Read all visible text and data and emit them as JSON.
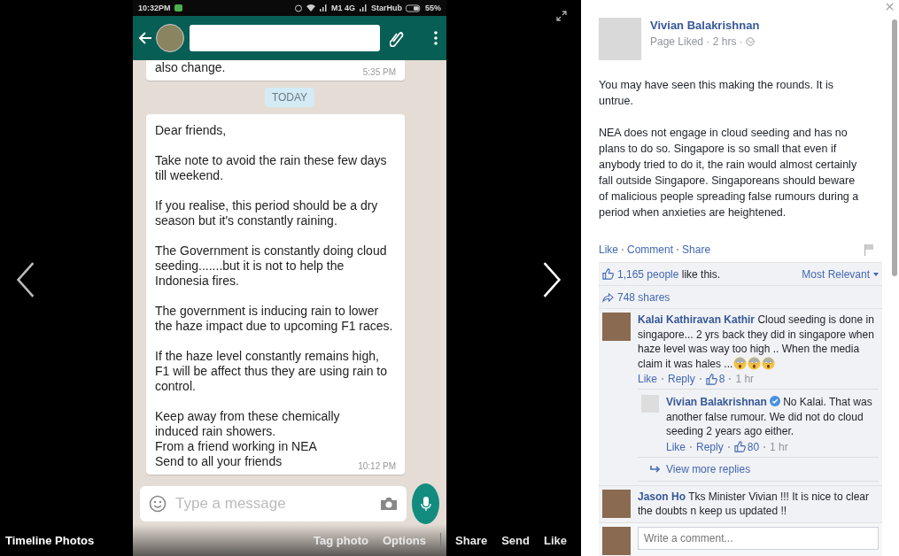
{
  "photo_viewer": {
    "album": "Timeline Photos",
    "photo_actions": [
      "Tag photo",
      "Options"
    ],
    "share_actions": [
      "Share",
      "Send",
      "Like"
    ]
  },
  "phone": {
    "status_bar": {
      "time": "10:32PM",
      "carrier_1": "M1 4G",
      "carrier_2": "StarHub",
      "battery": "55%"
    },
    "messages": [
      {
        "kind": "bubble",
        "paragraphs": [
          "also change."
        ],
        "time": "5:35 PM"
      },
      {
        "kind": "date",
        "text": "TODAY"
      },
      {
        "kind": "bubble",
        "paragraphs": [
          "Dear friends,",
          "Take note to avoid the rain these few days till weekend.",
          "If you realise, this period should be a dry season but it's constantly raining.",
          "The Government is constantly doing cloud seeding.......but it is not to help the Indonesia fires.",
          "The government is inducing rain to lower the haze impact due to upcoming F1 races.",
          "If the haze level constantly remains high, F1 will be affect thus they are using rain to control.",
          "Keep away from these chemically induced rain showers.\nFrom a friend working in NEA\nSend to all your friends"
        ],
        "time": "10:12 PM"
      }
    ],
    "composer": {
      "placeholder": "Type a message"
    }
  },
  "post": {
    "author": "Vivian Balakrishnan",
    "meta": "Page Liked · 2 hrs ·",
    "paragraphs": [
      "You may have seen this making the rounds. It is untrue.",
      "NEA does not engage in cloud seeding and has no plans to do so. Singapore is so small that even if anybody tried to do it, the rain would almost certainly fall outside Singapore. Singaporeans should beware of malicious people spreading false rumours during a period when anxieties are heightened."
    ],
    "actions": [
      "Like",
      "Comment",
      "Share"
    ],
    "likes": {
      "count": "1,165 people",
      "suffix": "like this."
    },
    "sort": "Most Relevant",
    "shares": "748 shares",
    "comments": [
      {
        "author": "Kalai Kathiravan Kathir",
        "verified": false,
        "text": "Cloud seeding is done in singapore... 2 yrs back they did in singapore when haze level was way too high .. When the media claim it was hales ...",
        "trailing_icons": [
          {
            "kind": "scream"
          },
          {
            "kind": "scream"
          },
          {
            "kind": "scream"
          }
        ],
        "actions": [
          "Like",
          "Reply"
        ],
        "likes": "8",
        "time": "1 hr",
        "replies": [
          {
            "author": "Vivian Balakrishnan",
            "verified": true,
            "text": "No Kalai. That was another false rumour. We did not do cloud seeding 2 years ago either.",
            "actions": [
              "Like",
              "Reply"
            ],
            "likes": "80",
            "time": "1 hr"
          }
        ],
        "more_replies": "View more replies"
      },
      {
        "author": "Jason Ho",
        "verified": false,
        "text": "Tks Minister Vivian !!! It is nice to clear the doubts n keep us updated !!"
      }
    ],
    "composer": {
      "placeholder": "Write a comment..."
    }
  }
}
